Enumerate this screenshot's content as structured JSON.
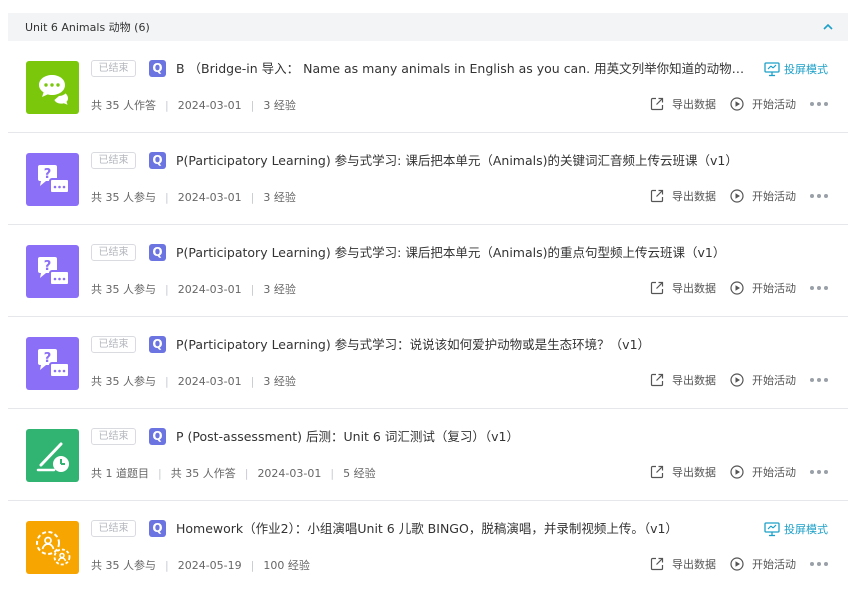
{
  "header": {
    "title": "Unit 6 Animals 动物 (6)",
    "collapse_icon": "chevron-up-icon"
  },
  "labels": {
    "export": "导出数据",
    "start": "开始活动",
    "projection": "投屏模式"
  },
  "colors": {
    "chat": "#7ac70c",
    "question": "#8c6ff7",
    "quiz": "#31b472",
    "homework": "#f7a500",
    "projection": "#1da0c8",
    "q_badge": "#6b74e0"
  },
  "items": [
    {
      "badge": "已结束",
      "type_letter": "Q",
      "icon": "chat-bubbles-icon",
      "title": "B （Bridge-in 导入： Name as many animals in English as you can. 用英文列举你知道的动物名称，...",
      "meta": [
        "共 35 人作答",
        "2024-03-01",
        "3 经验"
      ],
      "has_projection": true
    },
    {
      "badge": "已结束",
      "type_letter": "Q",
      "icon": "question-answer-icon",
      "title": "P(Participatory Learning) 参与式学习: 课后把本单元（Animals)的关键词汇音频上传云班课（v1）",
      "meta": [
        "共 35 人参与",
        "2024-03-01",
        "3 经验"
      ],
      "has_projection": false
    },
    {
      "badge": "已结束",
      "type_letter": "Q",
      "icon": "question-answer-icon",
      "title": "P(Participatory Learning) 参与式学习: 课后把本单元（Animals)的重点句型频上传云班课（v1）",
      "meta": [
        "共 35 人参与",
        "2024-03-01",
        "3 经验"
      ],
      "has_projection": false
    },
    {
      "badge": "已结束",
      "type_letter": "Q",
      "icon": "question-answer-icon",
      "title": "P(Participatory Learning) 参与式学习：说说该如何爱护动物或是生态环境？（v1）",
      "meta": [
        "共 35 人参与",
        "2024-03-01",
        "3 经验"
      ],
      "has_projection": false
    },
    {
      "badge": "已结束",
      "type_letter": "Q",
      "icon": "pen-clock-quiz-icon",
      "title": "P (Post-assessment) 后测：Unit 6 词汇测试（复习）（v1）",
      "meta": [
        "共 1 道题目",
        "共 35 人作答",
        "2024-03-01",
        "5 经验"
      ],
      "has_projection": false
    },
    {
      "badge": "已结束",
      "type_letter": "Q",
      "icon": "group-gears-icon",
      "title": "Homework（作业2）：小组演唱Unit 6 儿歌 BINGO，脱稿演唱，并录制视频上传。（v1）",
      "meta": [
        "共 35 人参与",
        "2024-05-19",
        "100 经验"
      ],
      "has_projection": true
    }
  ]
}
